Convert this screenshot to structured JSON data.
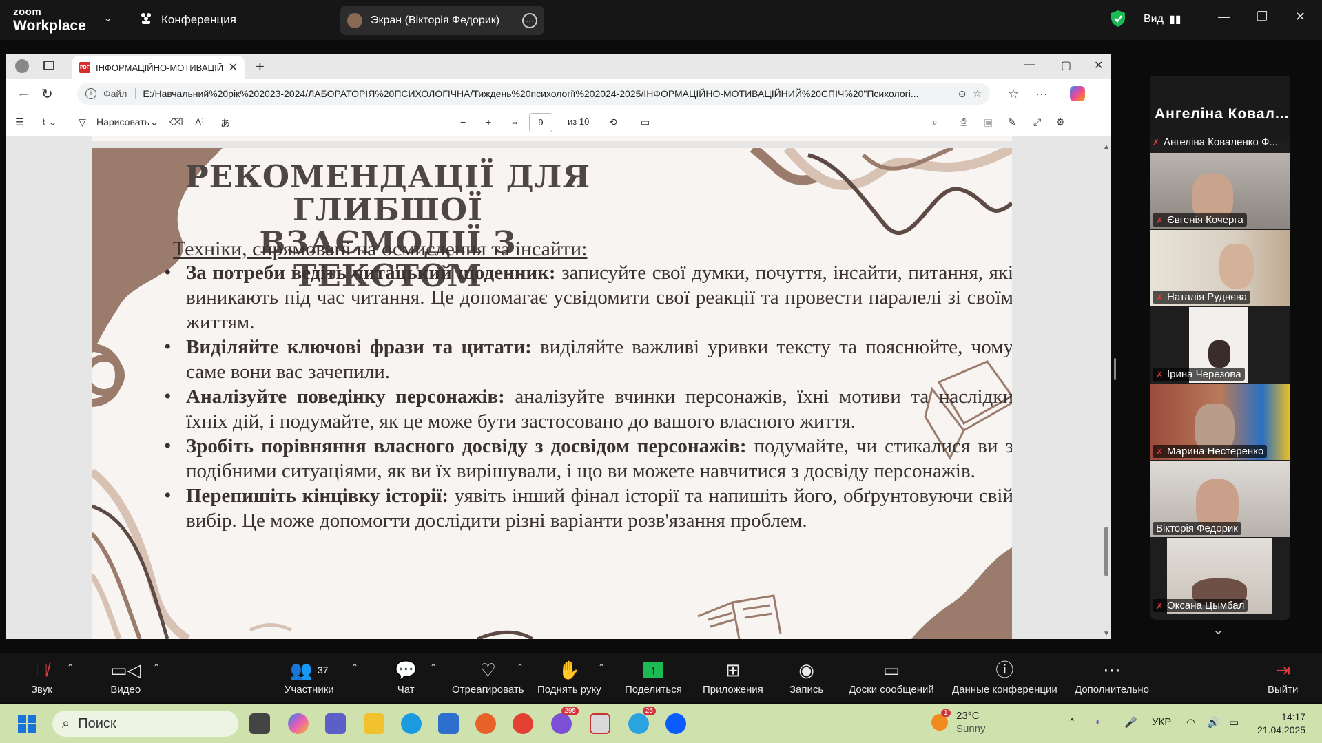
{
  "zoom": {
    "logo_small": "zoom",
    "logo_big": "Workplace",
    "meeting_label": "Конференция",
    "share_label": "Экран (Вікторія Федорик)",
    "view_label": "Вид"
  },
  "browser": {
    "tab_title": "ІНФОРМАЦІЙНО-МОТИВАЦІЙН",
    "url_label": "Файл",
    "url": "E:/Навчальний%20рік%202023-2024/ЛАБОРАТОРІЯ%20ПСИХОЛОГІЧНА/Тиждень%20психології%202024-2025/ІНФОРМАЦІЙНО-МОТИВАЦІЙНИЙ%20СПІЧ%20\"Психологі..."
  },
  "pdf_toolbar": {
    "draw_label": "Нарисовать",
    "page_current": "9",
    "page_total": "из 10"
  },
  "slide": {
    "title_line1": "РЕКОМЕНДАЦІЇ ДЛЯ ГЛИБШОЇ",
    "title_line2": "ВЗАЄМОДІЇ З ТЕКСТОМ",
    "subtitle": "Техніки, спрямовані на осмислення та інсайти:",
    "items": [
      {
        "bold": "За потреби ведіть читацький щоденник:",
        "text": " записуйте свої думки, почуття, інсайти, питання, які виникають під час читання. Це допомагає усвідомити свої реакції та провести паралелі зі своїм життям."
      },
      {
        "bold": "Виділяйте ключові фрази та цитати:",
        "text": " виділяйте важливі уривки тексту та пояснюйте, чому саме вони вас зачепили."
      },
      {
        "bold": "Аналізуйте поведінку персонажів:",
        "text": " аналізуйте вчинки персонажів, їхні мотиви та наслідки їхніх дій, і подумайте, як це може бути застосовано до вашого власного життя."
      },
      {
        "bold": "Зробіть порівняння власного досвіду з досвідом персонажів:",
        "text": " подумайте, чи стикалися ви з подібними ситуаціями, як ви їх вирішували, і що ви можете навчитися з досвіду персонажів."
      },
      {
        "bold": "Перепишіть кінцівку історії:",
        "text": " уявіть інший фінал історії та напишіть його, обґрунтовуючи свій вибір. Це може допомогти дослідити різні варіанти розв'язання проблем."
      }
    ]
  },
  "gallery": {
    "header_name": "Ангеліна Ковал...",
    "header_label": "Ангеліна Коваленко Ф...",
    "participants": [
      {
        "name": "Євгенія Кочерга",
        "muted": true
      },
      {
        "name": "Наталія Руднєва",
        "muted": true
      },
      {
        "name": "Ірина Черезова",
        "muted": true
      },
      {
        "name": "Марина Нестеренко",
        "muted": true
      },
      {
        "name": "Вікторія Федорик",
        "muted": false
      },
      {
        "name": "Оксана Цымбал",
        "muted": true
      }
    ]
  },
  "toolbar": {
    "audio": "Звук",
    "video": "Видео",
    "participants": "Участники",
    "participants_count": "37",
    "chat": "Чат",
    "react": "Отреагировать",
    "raise_hand": "Поднять руку",
    "share": "Поделиться",
    "apps": "Приложения",
    "record": "Запись",
    "whiteboards": "Доски сообщений",
    "meeting_info": "Данные конференции",
    "more": "Дополнительно",
    "leave": "Выйти"
  },
  "taskbar": {
    "search_placeholder": "Поиск",
    "weather_temp": "23°C",
    "weather_desc": "Sunny",
    "weather_badge": "1",
    "lang": "УКР",
    "time": "14:17",
    "date": "21.04.2025",
    "badge_viber": "295",
    "badge_telegram": "25"
  },
  "colors": {
    "zoom_bg": "#161616",
    "share_green": "#1db954",
    "active_speaker": "#20c36d",
    "slide_bg": "#f7f4f2",
    "slide_brown": "#8b6b5c",
    "taskbar_bg": "#cfe2ad"
  }
}
